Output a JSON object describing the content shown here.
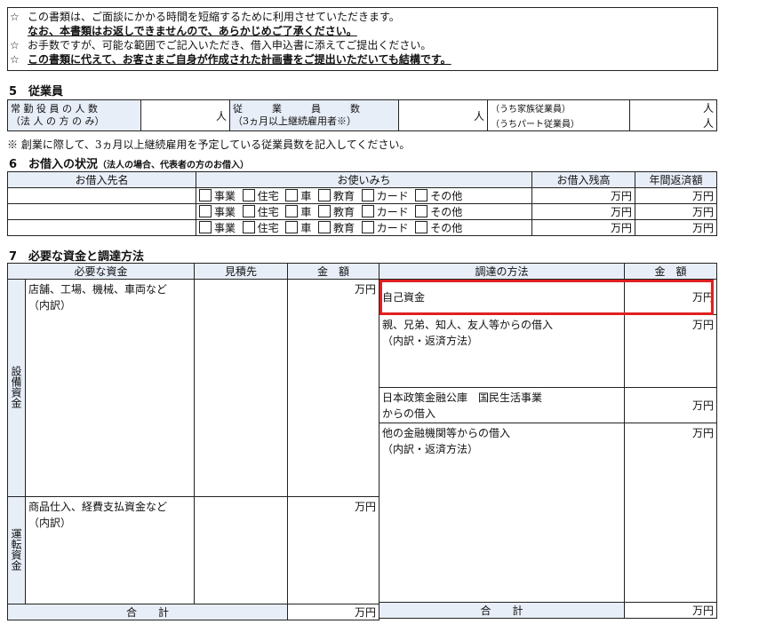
{
  "notice": {
    "star": "☆",
    "line1": "この書類は、ご面談にかかる時間を短縮するために利用させていただきます。",
    "line2": "なお、本書類はお返しできませんので、あらかじめご了承ください。",
    "line3": "お手数ですが、可能な範囲でご記入いただき、借入申込書に添えてご提出ください。",
    "line4": "この書類に代えて、お客さまご自身が作成された計画書をご提出いただいても結構です。"
  },
  "section5": {
    "heading": "5　従業員",
    "officers_label1": "常 勤 役 員 の 人 数",
    "officers_label2": "（法 人 の 方 の み）",
    "unit_person": "人",
    "employees_label1": "従　　　業　　　員　　　数",
    "employees_label2": "（3ヵ月以上継続雇用者※）",
    "family_label": "（うち家族従業員）",
    "part_label": "（うちパート従業員）",
    "note": "※ 創業に際して、3ヵ月以上継続雇用を予定している従業員数を記入してください。"
  },
  "section6": {
    "heading": "6　お借入の状況",
    "heading_note": "（法人の場合、代表者の方のお借入）",
    "col_lender": "お借入先名",
    "col_purpose": "お使いみち",
    "col_balance": "お借入残高",
    "col_annual": "年間返済額",
    "options": [
      "事業",
      "住宅",
      "車",
      "教育",
      "カード",
      "その他"
    ],
    "unit_man": "万円",
    "rows": [
      {
        "lender": ""
      },
      {
        "lender": ""
      },
      {
        "lender": ""
      }
    ]
  },
  "section7": {
    "heading": "7　必要な資金と調達方法",
    "col_need": "必要な資金",
    "col_quote": "見積先",
    "col_amount": "金　額",
    "col_method": "調達の方法",
    "col_amount2": "金　額",
    "equip_label": "設備資金",
    "equip_text1": "店舗、工場、機械、車両など",
    "equip_text2": "（内訳）",
    "oper_label": "運転資金",
    "oper_text1": "商品仕入、経費支払資金など",
    "oper_text2": "（内訳）",
    "unit_man": "万円",
    "self_fund": "自己資金",
    "family_loan1": "親、兄弟、知人、友人等からの借入",
    "family_loan2": "（内訳・返済方法）",
    "jfc1": "日本政策金融公庫　国民生活事業",
    "jfc2": "からの借入",
    "other_loan1": "他の金融機関等からの借入",
    "other_loan2": "（内訳・返済方法）",
    "total": "合　　計"
  }
}
